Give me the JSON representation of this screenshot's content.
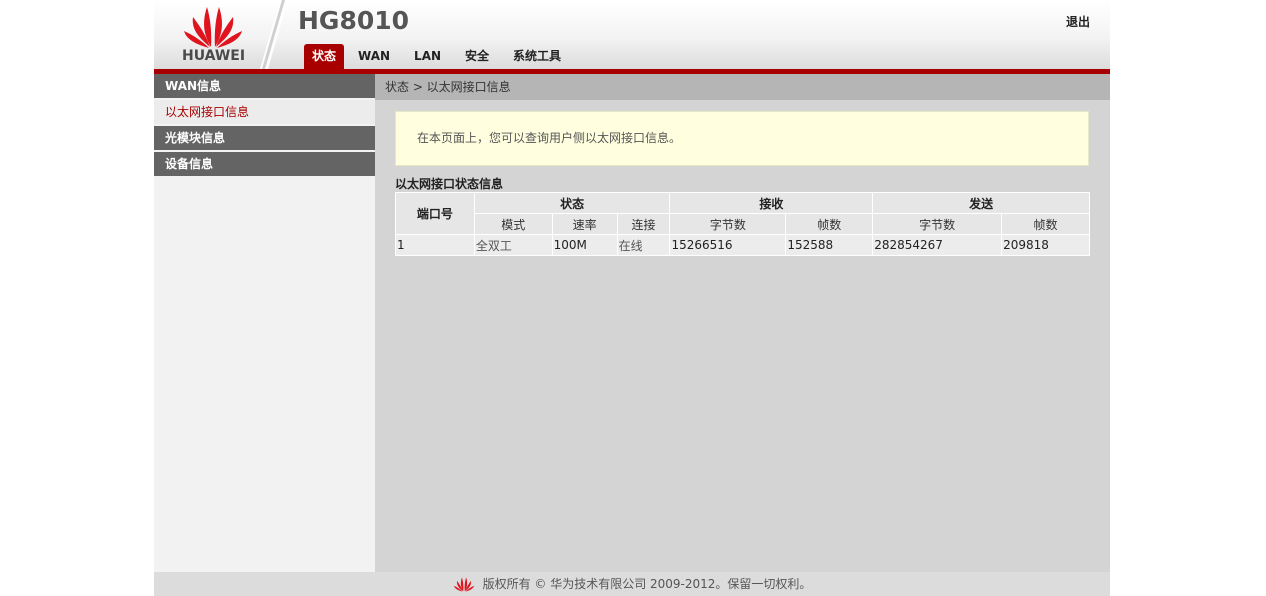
{
  "header": {
    "brand": "HUAWEI",
    "model": "HG8010",
    "logout_label": "退出"
  },
  "nav": {
    "tabs": [
      {
        "label": "状态",
        "active": true
      },
      {
        "label": "WAN",
        "active": false
      },
      {
        "label": "LAN",
        "active": false
      },
      {
        "label": "安全",
        "active": false
      },
      {
        "label": "系统工具",
        "active": false
      }
    ]
  },
  "sidebar": {
    "items": [
      {
        "label": "WAN信息",
        "selected": false
      },
      {
        "label": "以太网接口信息",
        "selected": true
      },
      {
        "label": "光模块信息",
        "selected": false
      },
      {
        "label": "设备信息",
        "selected": false
      }
    ]
  },
  "breadcrumb": "状态 > 以太网接口信息",
  "notice": "在本页面上，您可以查询用户侧以太网接口信息。",
  "table": {
    "title": "以太网接口状态信息",
    "headers": {
      "port": "端口号",
      "status": "状态",
      "receive": "接收",
      "send": "发送",
      "mode": "模式",
      "rate": "速率",
      "link": "连接",
      "rx_bytes": "字节数",
      "rx_frames": "帧数",
      "tx_bytes": "字节数",
      "tx_frames": "帧数"
    },
    "rows": [
      {
        "port": "1",
        "mode": "全双工",
        "rate": "100M",
        "link": "在线",
        "rx_bytes": "15266516",
        "rx_frames": "152588",
        "tx_bytes": "282854267",
        "tx_frames": "209818"
      }
    ]
  },
  "footer": {
    "copyright": "版权所有 © 华为技术有限公司 2009-2012。保留一切权利。"
  },
  "colors": {
    "accent": "#a80000",
    "sidebar_item": "#646464",
    "notice_bg": "#ffffe0"
  }
}
